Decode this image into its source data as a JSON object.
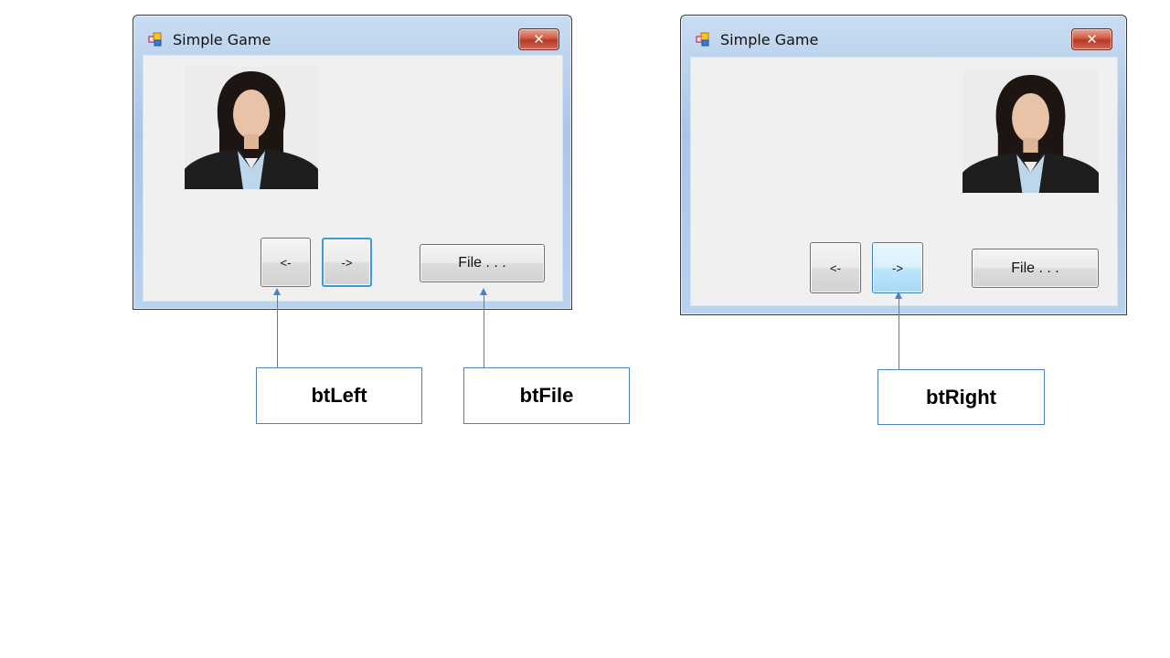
{
  "windows": [
    {
      "title": "Simple Game",
      "close_label": "✕",
      "buttons": {
        "left_label": "<-",
        "right_label": "->",
        "file_label": "File . . ."
      },
      "photo_position": "left",
      "focused_button": "right"
    },
    {
      "title": "Simple Game",
      "close_label": "✕",
      "buttons": {
        "left_label": "<-",
        "right_label": "->",
        "file_label": "File . . ."
      },
      "photo_position": "right",
      "hovered_button": "right"
    }
  ],
  "callouts": {
    "bt_left": "btLeft",
    "bt_file": "btFile",
    "bt_right": "btRight"
  },
  "colors": {
    "callout_line": "#4f81bd",
    "focus_border": "#3c9bd6",
    "hover_fill": "#bee6fd",
    "close_button": "#cf5a44",
    "client_background": "#f0f0f0"
  },
  "icons": [
    "app-icon",
    "close-icon"
  ]
}
